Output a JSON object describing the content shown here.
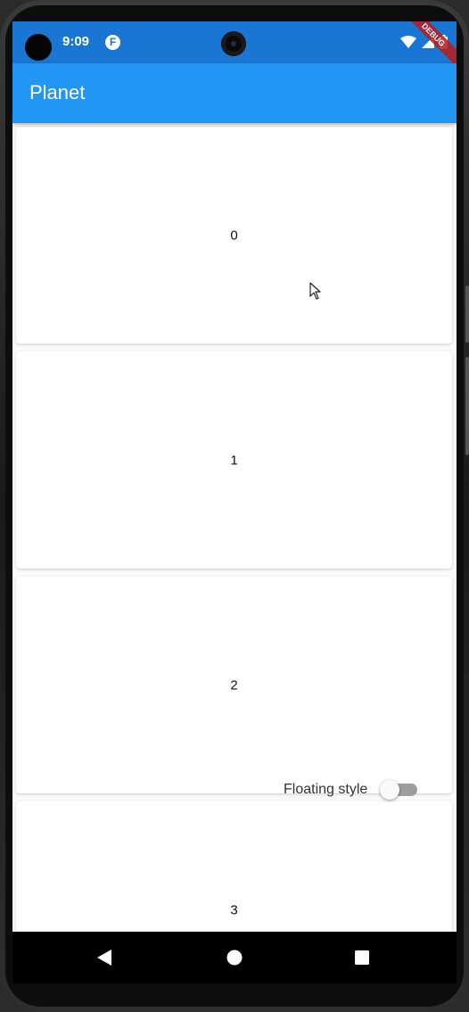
{
  "status_bar": {
    "time": "9:09",
    "app_icon_letter": "F",
    "debug_banner": "DEBUG",
    "icons": [
      "wifi-icon",
      "signal-icon",
      "battery-icon"
    ]
  },
  "app_bar": {
    "title": "Planet",
    "color": "#2196f3",
    "status_color": "#1976d2"
  },
  "list": {
    "items": [
      {
        "label": "0"
      },
      {
        "label": "1"
      },
      {
        "label": "2"
      },
      {
        "label": "3"
      }
    ]
  },
  "floating_control": {
    "label": "Floating style",
    "enabled": false
  },
  "nav_bar": {
    "buttons": [
      "back-icon",
      "home-icon",
      "recents-icon"
    ]
  }
}
